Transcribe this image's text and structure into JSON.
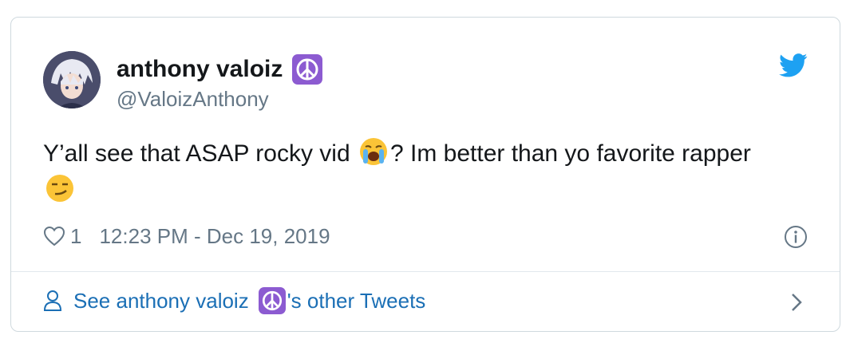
{
  "author": {
    "display_name": "anthony valoiz",
    "handle": "@ValoizAnthony",
    "badge_icon": "peace-symbol-icon"
  },
  "tweet": {
    "text_part1": "Y’all see that ASAP rocky vid ",
    "emoji1": "loudly-crying-face-emoji",
    "text_part2": "? Im better than yo favorite rapper",
    "emoji2": "smirking-face-emoji"
  },
  "meta": {
    "like_count": "1",
    "timestamp": "12:23 PM - Dec 19, 2019"
  },
  "footer": {
    "prefix": "See anthony valoiz ",
    "suffix": "'s other Tweets"
  },
  "colors": {
    "brand_blue": "#1da1f2",
    "link_blue": "#1b6fb5",
    "peace_purple": "#8c5bd1",
    "muted_gray": "#657786"
  }
}
